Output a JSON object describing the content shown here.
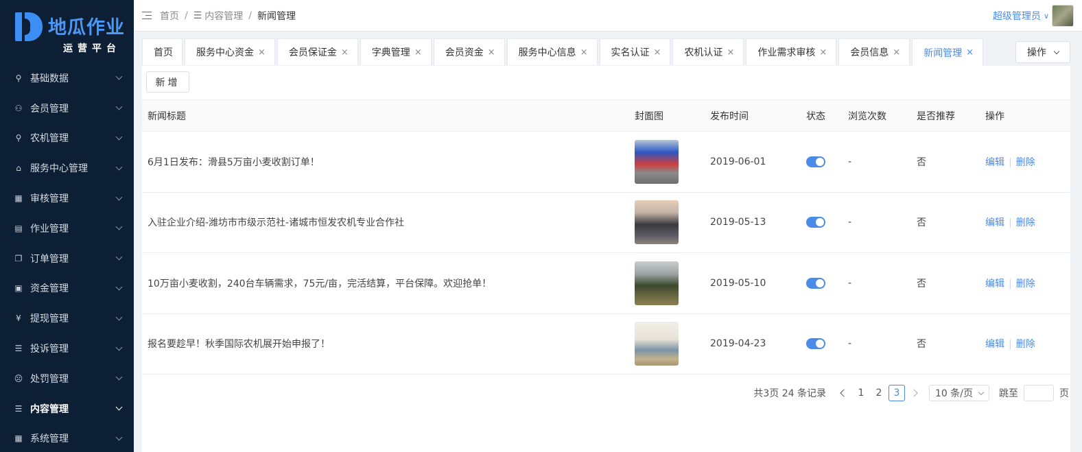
{
  "brand": {
    "title": "地瓜作业",
    "subtitle": "运营平台"
  },
  "sidebar": {
    "items": [
      {
        "label": "基础数据",
        "icon": "wrench-icon",
        "glyph": "⚲"
      },
      {
        "label": "会员管理",
        "icon": "user-icon",
        "glyph": "⚇"
      },
      {
        "label": "农机管理",
        "icon": "wrench-icon",
        "glyph": "⚲"
      },
      {
        "label": "服务中心管理",
        "icon": "home-icon",
        "glyph": "⌂"
      },
      {
        "label": "审核管理",
        "icon": "table-icon",
        "glyph": "▦"
      },
      {
        "label": "作业管理",
        "icon": "document-icon",
        "glyph": "▤"
      },
      {
        "label": "订单管理",
        "icon": "copy-icon",
        "glyph": "❐"
      },
      {
        "label": "资金管理",
        "icon": "wallet-icon",
        "glyph": "▣"
      },
      {
        "label": "提现管理",
        "icon": "yen-circle-icon",
        "glyph": "¥"
      },
      {
        "label": "投诉管理",
        "icon": "feedback-icon",
        "glyph": "☰"
      },
      {
        "label": "处罚管理",
        "icon": "frown-icon",
        "glyph": "☹"
      },
      {
        "label": "内容管理",
        "icon": "list-icon",
        "glyph": "☰"
      },
      {
        "label": "系统管理",
        "icon": "grid-icon",
        "glyph": "▦"
      }
    ],
    "active_index": 11
  },
  "header": {
    "breadcrumb": {
      "home": "首页",
      "section": "内容管理",
      "current": "新闻管理",
      "sep": "/"
    },
    "user_name": "超级管理员"
  },
  "tabs": [
    {
      "label": "首页",
      "closable": false
    },
    {
      "label": "服务中心资金",
      "closable": true
    },
    {
      "label": "会员保证金",
      "closable": true
    },
    {
      "label": "字典管理",
      "closable": true
    },
    {
      "label": "会员资金",
      "closable": true
    },
    {
      "label": "服务中心信息",
      "closable": true
    },
    {
      "label": "实名认证",
      "closable": true
    },
    {
      "label": "农机认证",
      "closable": true
    },
    {
      "label": "作业需求审核",
      "closable": true
    },
    {
      "label": "会员信息",
      "closable": true
    },
    {
      "label": "新闻管理",
      "closable": true,
      "active": true
    }
  ],
  "tab_close_glyph": "×",
  "ops_button": "操作",
  "add_button": "新增",
  "table": {
    "columns": {
      "title": "新闻标题",
      "cover": "封面图",
      "time": "发布时间",
      "status": "状态",
      "views": "浏览次数",
      "recommend": "是否推荐",
      "ops": "操作"
    },
    "rows": [
      {
        "title": "6月1日发布：滑县5万亩小麦收割订单！",
        "date": "2019-06-01",
        "status": true,
        "views": "-",
        "recommend": "否"
      },
      {
        "title": "入驻企业介绍-潍坊市市级示范社-诸城市恒发农机专业合作社",
        "date": "2019-05-13",
        "status": true,
        "views": "-",
        "recommend": "否"
      },
      {
        "title": "10万亩小麦收割，240台车辆需求，75元/亩，完活结算，平台保障。欢迎抢单！",
        "date": "2019-05-10",
        "status": true,
        "views": "-",
        "recommend": "否"
      },
      {
        "title": "报名要趁早！秋季国际农机展开始申报了！",
        "date": "2019-04-23",
        "status": true,
        "views": "-",
        "recommend": "否"
      }
    ],
    "edit_label": "编辑",
    "delete_label": "删除",
    "op_sep": "|"
  },
  "pagination": {
    "total_text": "共3页 24 条记录",
    "pages": [
      "1",
      "2",
      "3"
    ],
    "current": "3",
    "page_size": "10 条/页",
    "jump_label": "跳至",
    "page_unit": "页"
  },
  "colors": {
    "sidebar_bg": "#0d1f35",
    "accent": "#4a8be8"
  }
}
